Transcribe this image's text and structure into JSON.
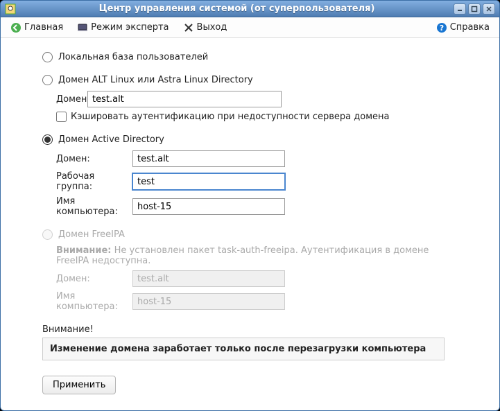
{
  "window": {
    "title": "Центр управления системой (от суперпользователя)"
  },
  "toolbar": {
    "home": "Главная",
    "expert": "Режим эксперта",
    "exit": "Выход",
    "help": "Справка"
  },
  "options": {
    "local": {
      "label": "Локальная база пользователей"
    },
    "alt": {
      "label": "Домен ALT Linux или Astra Linux Directory",
      "domain_label": "Домен:",
      "domain_value": "test.alt",
      "cache_label": "Кэшировать аутентификацию при недоступности сервера домена"
    },
    "ad": {
      "label": "Домен Active Directory",
      "domain_label": "Домен:",
      "domain_value": "test.alt",
      "workgroup_label": "Рабочая группа:",
      "workgroup_value": "test",
      "hostname_label": "Имя компьютера:",
      "hostname_value": "host-15"
    },
    "freeipa": {
      "label": "Домен FreeIPA",
      "warn_prefix": "Внимание:",
      "warn_text": " Не установлен пакет task-auth-freeipa. Аутентификация в домене FreeIPA недоступна.",
      "domain_label": "Домен:",
      "domain_value": "test.alt",
      "hostname_label": "Имя компьютера:",
      "hostname_value": "host-15"
    },
    "selected": "ad"
  },
  "attention": {
    "label": "Внимание!",
    "text": "Изменение домена заработает только после перезагрузки компьютера"
  },
  "buttons": {
    "apply": "Применить"
  }
}
